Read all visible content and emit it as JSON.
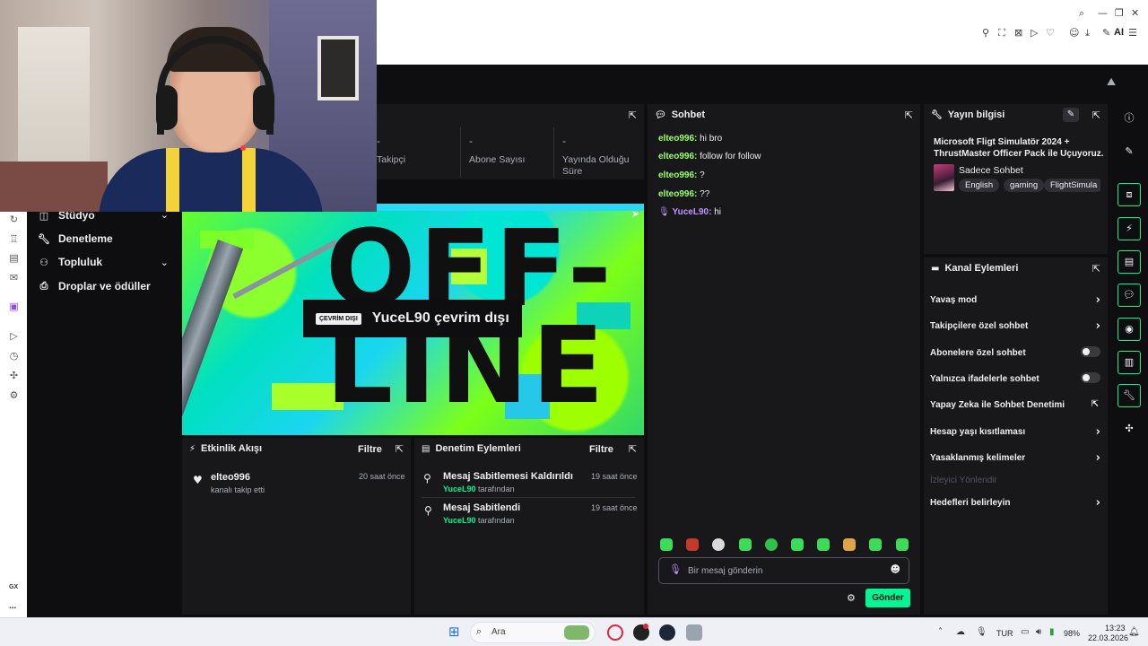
{
  "browser": {
    "ai_label": "AI"
  },
  "nav": {
    "items": [
      {
        "label": "Stüdyo",
        "icon": "studio-icon"
      },
      {
        "label": "Denetleme",
        "icon": "wrench-icon"
      },
      {
        "label": "Topluluk",
        "icon": "community-icon"
      },
      {
        "label": "Droplar ve ödüller",
        "icon": "drops-icon"
      }
    ]
  },
  "stats": {
    "followers": {
      "value": "-",
      "label": "Takipçi"
    },
    "subscribers": {
      "value": "-",
      "label": "Abone Sayısı"
    },
    "live_duration": {
      "value": "-",
      "label": "Yayında Olduğu Süre"
    }
  },
  "video": {
    "overlay_text": "OFF-LINE",
    "offline_badge": "ÇEVRİM DIŞI",
    "offline_title": "YuceL90 çevrim dışı"
  },
  "activity": {
    "title": "Etkinlik Akışı",
    "filter": "Filtre",
    "items": [
      {
        "user": "elteo996",
        "action": "kanalı takip etti",
        "time": "20 saat önce"
      }
    ]
  },
  "moderation": {
    "title": "Denetim Eylemleri",
    "filter": "Filtre",
    "items": [
      {
        "action": "Mesaj Sabitlemesi Kaldırıldı",
        "by": "YuceL90",
        "by_suffix": "tarafından",
        "time": "19 saat önce"
      },
      {
        "action": "Mesaj Sabitlendi",
        "by": "YuceL90",
        "by_suffix": "tarafından",
        "time": "19 saat önce"
      }
    ]
  },
  "chat": {
    "title": "Sohbet",
    "messages": [
      {
        "user": "elteo996:",
        "text": "hi bro"
      },
      {
        "user": "elteo996:",
        "text": "follow for follow"
      },
      {
        "user": "elteo996:",
        "text": "?"
      },
      {
        "user": "elteo996:",
        "text": "??"
      },
      {
        "user": "YuceL90:",
        "text": "hi"
      }
    ],
    "input_placeholder": "Bir mesaj gönderin",
    "send_label": "Gönder"
  },
  "stream_info": {
    "title": "Yayın bilgisi",
    "stream_title": "Microsoft Fligt Simulatör 2024 + ThrustMaster Officer Pack ile Uçuyoruz.",
    "category": "Sadece Sohbet",
    "tags": [
      "English",
      "gaming",
      "FlightSimula"
    ]
  },
  "channel_actions": {
    "title": "Kanal Eylemleri",
    "rows": [
      {
        "label": "Yavaş mod",
        "control": "chevron"
      },
      {
        "label": "Takipçilere özel sohbet",
        "control": "chevron"
      },
      {
        "label": "Abonelere özel sohbet",
        "control": "toggle"
      },
      {
        "label": "Yalnızca ifadelerle sohbet",
        "control": "toggle"
      },
      {
        "label": "Yapay Zeka ile Sohbet Denetimi",
        "control": "external"
      },
      {
        "label": "Hesap yaşı kısıtlaması",
        "control": "chevron"
      },
      {
        "label": "Yasaklanmış kelimeler",
        "control": "chevron"
      },
      {
        "label": "İzleyici Yönlendir",
        "control": "none"
      },
      {
        "label": "Hedefleri belirleyin",
        "control": "chevron"
      }
    ]
  },
  "opera_sidebar": {
    "gx_label": "GX",
    "more_label": "..."
  },
  "taskbar": {
    "search_label": "Ara",
    "language": "TUR",
    "battery": "98%",
    "time": "13:23",
    "date": "22.03.2026"
  },
  "colors": {
    "accent_green": "#00f593",
    "chat_user_green": "#9aff6b",
    "chat_user_purple": "#bf94ff",
    "panel_bg": "#18181b",
    "page_bg": "#0e0e10"
  }
}
